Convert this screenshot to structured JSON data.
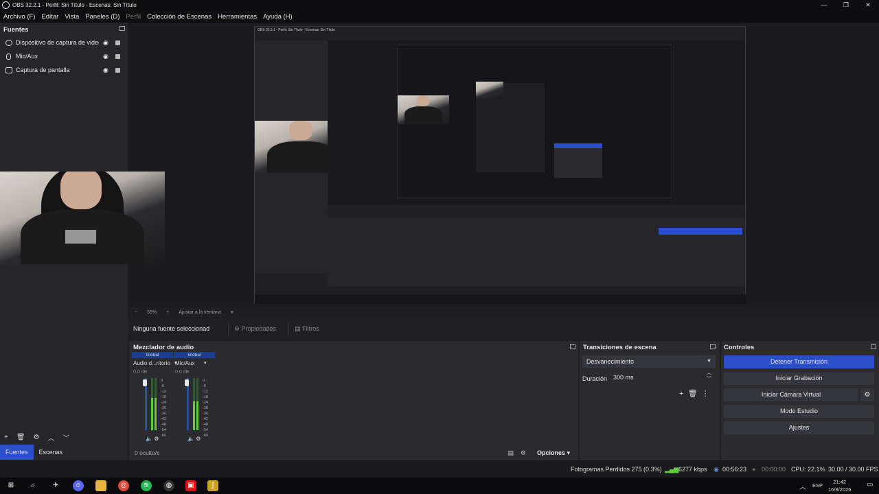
{
  "window": {
    "title": "OBS 32.2.1 - Perfil: Sin Título - Escenas: Sin Título",
    "controls": [
      "—",
      "❐",
      "✕"
    ]
  },
  "menu": {
    "items": [
      "Archivo (F)",
      "Editar",
      "Vista",
      "Paneles (D)",
      "Perfil",
      "Colección de Escenas",
      "Herramientas",
      "Ayuda (H)"
    ]
  },
  "sources": {
    "title": "Fuentes",
    "items": [
      {
        "label": "Dispositivo de captura de video",
        "icon": "camera-icon"
      },
      {
        "label": "Mic/Aux",
        "icon": "mic-icon"
      },
      {
        "label": "Captura de pantalla",
        "icon": "monitor-icon"
      }
    ],
    "toolbar": [
      "+",
      "🗑",
      "⚙",
      "︿",
      "﹀"
    ],
    "tabs": [
      "Fuentes",
      "Escenas"
    ]
  },
  "preview": {
    "inner_title": "OBS 32.2.1 - Perfil: Sin Título - Escenas: Sin Título",
    "zoom": "55%",
    "fit_label": "Ajustar a la ventana"
  },
  "props_bar": {
    "no_source": "Ninguna fuente seleccionad",
    "properties": "Propiedades",
    "filters": "Filtros"
  },
  "mixer": {
    "title": "Mezclador de audio",
    "channels": [
      {
        "badge": "Global",
        "name": "Audio d...ritorio",
        "db": "0.0 dB",
        "level": 0.62
      },
      {
        "badge": "Global",
        "name": "Mic/Aux",
        "db": "0.0 dB",
        "level": 0.55
      }
    ],
    "scale": [
      "0",
      "-6",
      "-12",
      "-18",
      "-24",
      "-30",
      "-36",
      "-42",
      "-48",
      "-54",
      "-60"
    ],
    "hidden": "0 oculto/s",
    "options": "Opciones"
  },
  "transitions": {
    "title": "Transiciones de escena",
    "selected": "Desvanecimiento",
    "duration_label": "Duración",
    "duration_value": "300 ms"
  },
  "controls": {
    "title": "Controles",
    "stop_stream": "Detener Transmisión",
    "start_recording": "Iniciar Grabación",
    "virtual_cam": "Iniciar Cámara Virtual",
    "studio_mode": "Modo Estudio",
    "settings": "Ajustes"
  },
  "status": {
    "dropped": "Fotogramas Perdidos 275 (0.3%)",
    "bitrate": "6277 kbps",
    "stream_time": "00:56:23",
    "rec_time": "00:00:00",
    "cpu": "CPU: 22.1%",
    "fps": "30.00 / 30.00 FPS"
  },
  "taskbar": {
    "lang": "ESP",
    "time": "21:42",
    "date": "16/8/2026"
  },
  "colors": {
    "accent": "#2a4fc6",
    "bg": "#1f1f23",
    "meter_green": "#5fcf3f"
  }
}
